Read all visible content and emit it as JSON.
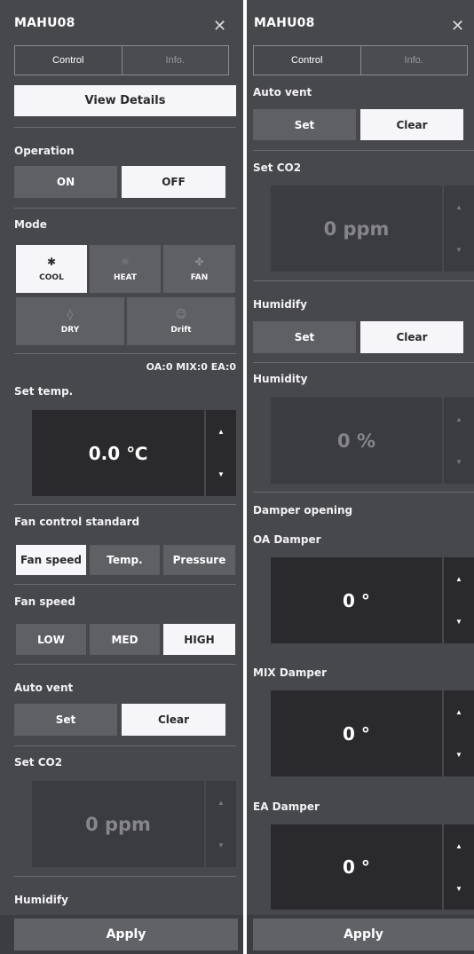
{
  "left": {
    "title": "MAHU08",
    "close_glyph": "✕",
    "tabs": [
      {
        "label": "Control"
      },
      {
        "label": "Info."
      }
    ],
    "view_details": "View Details",
    "operation": {
      "label": "Operation",
      "on": "ON",
      "off": "OFF",
      "selected": "OFF"
    },
    "mode": {
      "label": "Mode",
      "items": [
        {
          "label": "COOL",
          "icon": "snowflake-icon",
          "glyph": "✱"
        },
        {
          "label": "HEAT",
          "icon": "sun-icon",
          "glyph": "☼"
        },
        {
          "label": "FAN",
          "icon": "fan-icon",
          "glyph": "✤"
        },
        {
          "label": "DRY",
          "icon": "water-drop-icon",
          "glyph": "◊"
        },
        {
          "label": "Drift",
          "icon": "drift-icon",
          "glyph": "☺"
        }
      ],
      "selected": "COOL"
    },
    "damper_status": "OA:0 MIX:0 EA:0",
    "set_temp": {
      "label": "Set temp.",
      "value": "0.0 ℃"
    },
    "fan_control": {
      "label": "Fan control standard",
      "items": [
        "Fan speed",
        "Temp.",
        "Pressure"
      ],
      "selected": "Fan speed"
    },
    "fan_speed": {
      "label": "Fan speed",
      "items": [
        "LOW",
        "MED",
        "HIGH"
      ],
      "selected": "HIGH"
    },
    "auto_vent": {
      "label": "Auto vent",
      "set": "Set",
      "clear": "Clear",
      "selected": "Clear"
    },
    "set_co2": {
      "label": "Set CO2",
      "value": "0 ppm"
    },
    "humidify": {
      "label": "Humidify"
    },
    "apply": "Apply"
  },
  "right": {
    "title": "MAHU08",
    "close_glyph": "✕",
    "tabs": [
      {
        "label": "Control"
      },
      {
        "label": "Info."
      }
    ],
    "auto_vent": {
      "label": "Auto vent",
      "set": "Set",
      "clear": "Clear",
      "selected": "Clear"
    },
    "set_co2": {
      "label": "Set CO2",
      "value": "0 ppm"
    },
    "humidify": {
      "label": "Humidify",
      "set": "Set",
      "clear": "Clear",
      "selected": "Clear"
    },
    "humidity": {
      "label": "Humidity",
      "value": "0 %"
    },
    "damper_opening": {
      "label": "Damper opening"
    },
    "oa_damper": {
      "label": "OA Damper",
      "value": "0 °"
    },
    "mix_damper": {
      "label": "MIX Damper",
      "value": "0 °"
    },
    "ea_damper": {
      "label": "EA Damper",
      "value": "0 °"
    },
    "apply": "Apply"
  },
  "glyphs": {
    "up": "▲",
    "down": "▼"
  }
}
